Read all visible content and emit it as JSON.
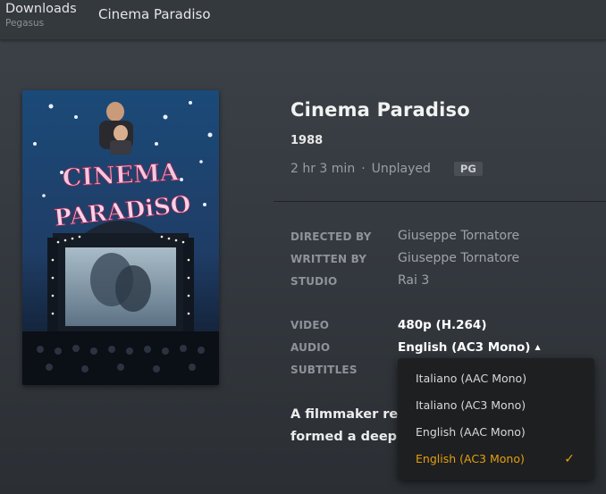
{
  "header": {
    "library_title": "Downloads",
    "library_subtitle": "Pegasus",
    "current_title": "Cinema Paradiso"
  },
  "poster": {
    "title_line1": "CINEMA",
    "title_line2": "PARADiSO"
  },
  "movie": {
    "title": "Cinema Paradiso",
    "year": "1988",
    "duration": "2 hr 3 min",
    "separator": "·",
    "status": "Unplayed",
    "rating": "PG"
  },
  "credits": [
    {
      "label": "DIRECTED BY",
      "value": "Giuseppe Tornatore"
    },
    {
      "label": "WRITTEN BY",
      "value": "Giuseppe Tornatore"
    },
    {
      "label": "STUDIO",
      "value": "Rai 3"
    }
  ],
  "media": {
    "video_label": "VIDEO",
    "video_value": "480p (H.264)",
    "audio_label": "AUDIO",
    "audio_value": "English (AC3 Mono)",
    "subtitles_label": "SUBTITLES"
  },
  "audio_menu": {
    "options": [
      {
        "label": "Italiano (AAC Mono)",
        "selected": false
      },
      {
        "label": "Italiano (AC3 Mono)",
        "selected": false
      },
      {
        "label": "English (AAC Mono)",
        "selected": false
      },
      {
        "label": "English (AC3 Mono)",
        "selected": true
      }
    ],
    "check_glyph": "✓"
  },
  "summary": {
    "line1": "A filmmaker reca                                           in",
    "line2": "formed a deep fr                                           oje"
  },
  "colors": {
    "accent": "#e5a00d",
    "background": "#383d43",
    "topbar": "#34393e",
    "dropdown": "#1e1f21"
  }
}
